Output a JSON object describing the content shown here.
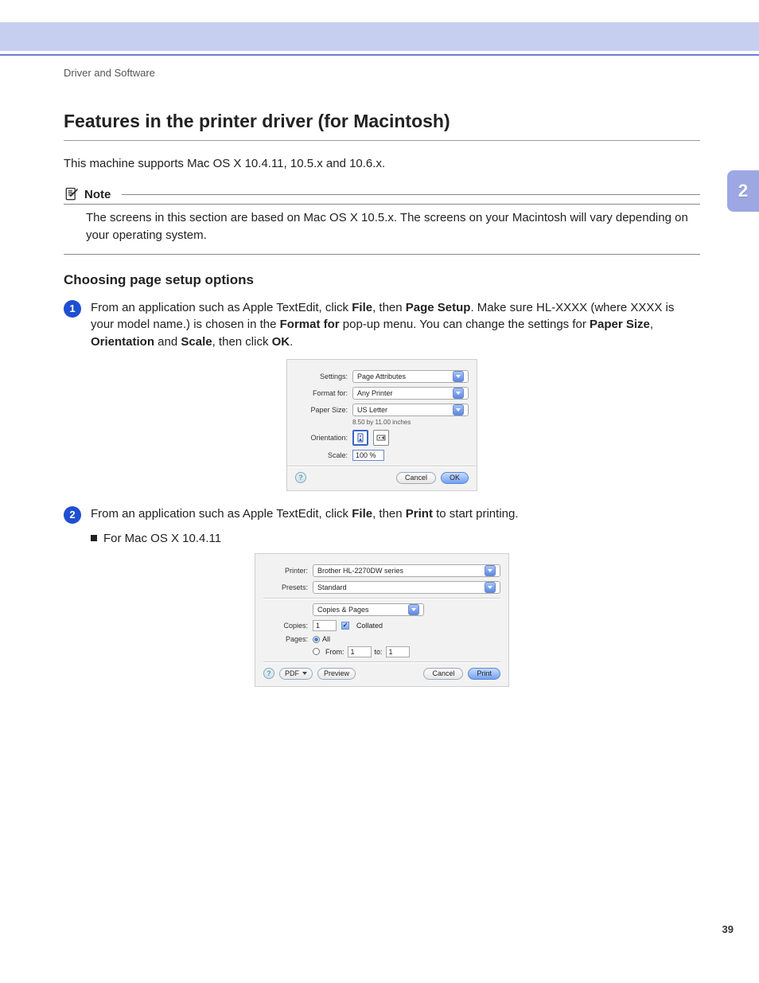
{
  "chapter_tab": "2",
  "page_number": "39",
  "breadcrumb": "Driver and Software",
  "h1": "Features in the printer driver (for Macintosh)",
  "intro": "This machine supports Mac OS X 10.4.11, 10.5.x and 10.6.x.",
  "note": {
    "label": "Note",
    "body": "The screens in this section are based on Mac OS X 10.5.x. The screens on your Macintosh will vary depending on your operating system."
  },
  "h2": "Choosing page setup options",
  "steps": {
    "s1": {
      "num": "1",
      "pre": "From an application such as Apple TextEdit, click ",
      "b1": "File",
      "mid1": ", then ",
      "b2": "Page Setup",
      "mid2": ". Make sure HL-XXXX (where XXXX is your model name.) is chosen in the ",
      "b3": "Format for",
      "mid3": " pop-up menu. You can change the settings for ",
      "b4": "Paper Size",
      "c1": ", ",
      "b5": "Orientation",
      "c2": " and ",
      "b6": "Scale",
      "mid4": ", then click ",
      "b7": "OK",
      "tail": "."
    },
    "s2": {
      "num": "2",
      "pre": "From an application such as Apple TextEdit, click ",
      "b1": "File",
      "mid1": ", then ",
      "b2": "Print",
      "tail": " to start printing.",
      "sub": "For Mac OS X 10.4.11"
    }
  },
  "dialog1": {
    "labels": {
      "settings": "Settings:",
      "format_for": "Format for:",
      "paper_size": "Paper Size:",
      "orientation": "Orientation:",
      "scale": "Scale:"
    },
    "values": {
      "settings": "Page Attributes",
      "format_for": "Any Printer",
      "paper_size": "US Letter",
      "dims": "8.50 by 11.00 inches",
      "scale": "100 %"
    },
    "buttons": {
      "cancel": "Cancel",
      "ok": "OK"
    }
  },
  "dialog2": {
    "labels": {
      "printer": "Printer:",
      "presets": "Presets:",
      "copies": "Copies:",
      "pages": "Pages:",
      "from": "From:",
      "to": "to:"
    },
    "values": {
      "printer": "Brother HL-2270DW series",
      "presets": "Standard",
      "panel": "Copies & Pages",
      "copies": "1",
      "collated": "Collated",
      "pages_all": "All",
      "from": "1",
      "to": "1"
    },
    "buttons": {
      "pdf": "PDF",
      "preview": "Preview",
      "cancel": "Cancel",
      "print": "Print"
    }
  }
}
